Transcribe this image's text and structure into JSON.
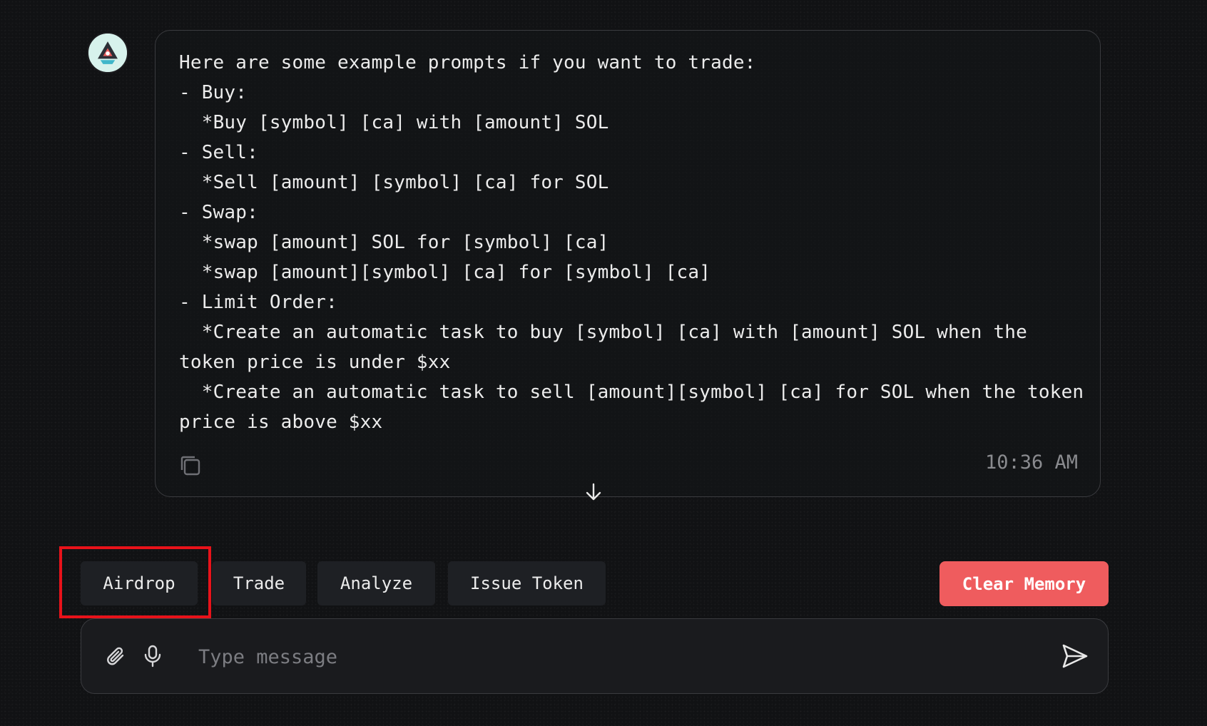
{
  "message": {
    "text": "Here are some example prompts if you want to trade:\n- Buy:\n  *Buy [symbol] [ca] with [amount] SOL\n- Sell:\n  *Sell [amount] [symbol] [ca] for SOL\n- Swap:\n  *swap [amount] SOL for [symbol] [ca]\n  *swap [amount][symbol] [ca] for [symbol] [ca]\n- Limit Order:\n  *Create an automatic task to buy [symbol] [ca] with [amount] SOL when the token price is under $xx\n  *Create an automatic task to sell [amount][symbol] [ca] for SOL when the token price is above $xx",
    "timestamp": "10:36 AM",
    "copy_icon": "copy-icon",
    "avatar_icon": "bot-avatar"
  },
  "quick_actions": [
    {
      "label": "Airdrop",
      "highlighted": true
    },
    {
      "label": "Trade"
    },
    {
      "label": "Analyze"
    },
    {
      "label": "Issue Token"
    }
  ],
  "clear_memory": {
    "label": "Clear Memory",
    "color": "#ef5c5e"
  },
  "composer": {
    "placeholder": "Type message",
    "value": "",
    "attach_icon": "paperclip-icon",
    "mic_icon": "microphone-icon",
    "send_icon": "send-icon"
  },
  "colors": {
    "background": "#111214",
    "highlight": "#e8121a",
    "chip_background": "#1e2024"
  }
}
